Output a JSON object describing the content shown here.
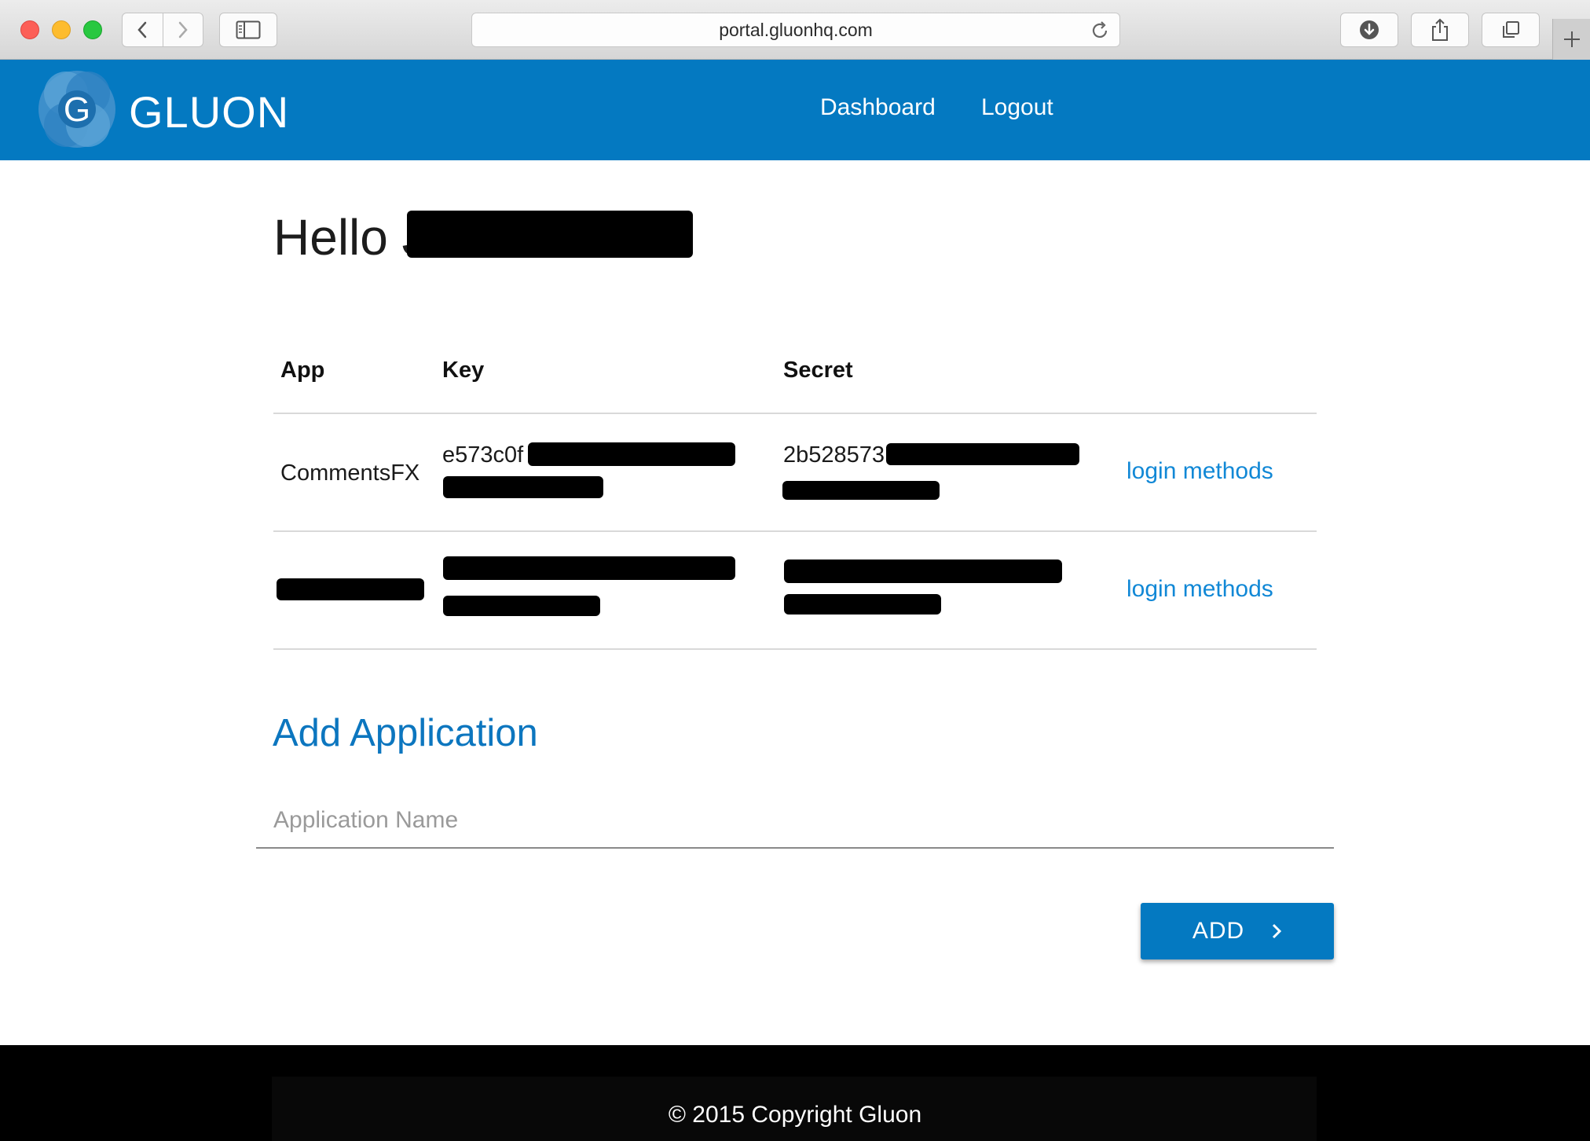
{
  "browser": {
    "url": "portal.gluonhq.com"
  },
  "header": {
    "brand": "GLUON",
    "brand_letter": "G",
    "nav": {
      "dashboard": "Dashboard",
      "logout": "Logout"
    },
    "colors": {
      "primary": "#0479c1",
      "link": "#1188d6"
    }
  },
  "main": {
    "greeting": "Hello J",
    "table": {
      "columns": {
        "app": "App",
        "key": "Key",
        "secret": "Secret"
      },
      "rows": [
        {
          "app": "CommentsFX",
          "key_line1": "e573c0f",
          "secret_line1": "2b528573",
          "action": "login methods"
        },
        {
          "app": "",
          "key_line1": "",
          "secret_line1": "",
          "action": "login methods"
        }
      ]
    },
    "add_section": {
      "title": "Add Application",
      "placeholder": "Application Name",
      "button_label": "ADD"
    }
  },
  "footer": {
    "copyright": "© 2015 Copyright Gluon"
  }
}
